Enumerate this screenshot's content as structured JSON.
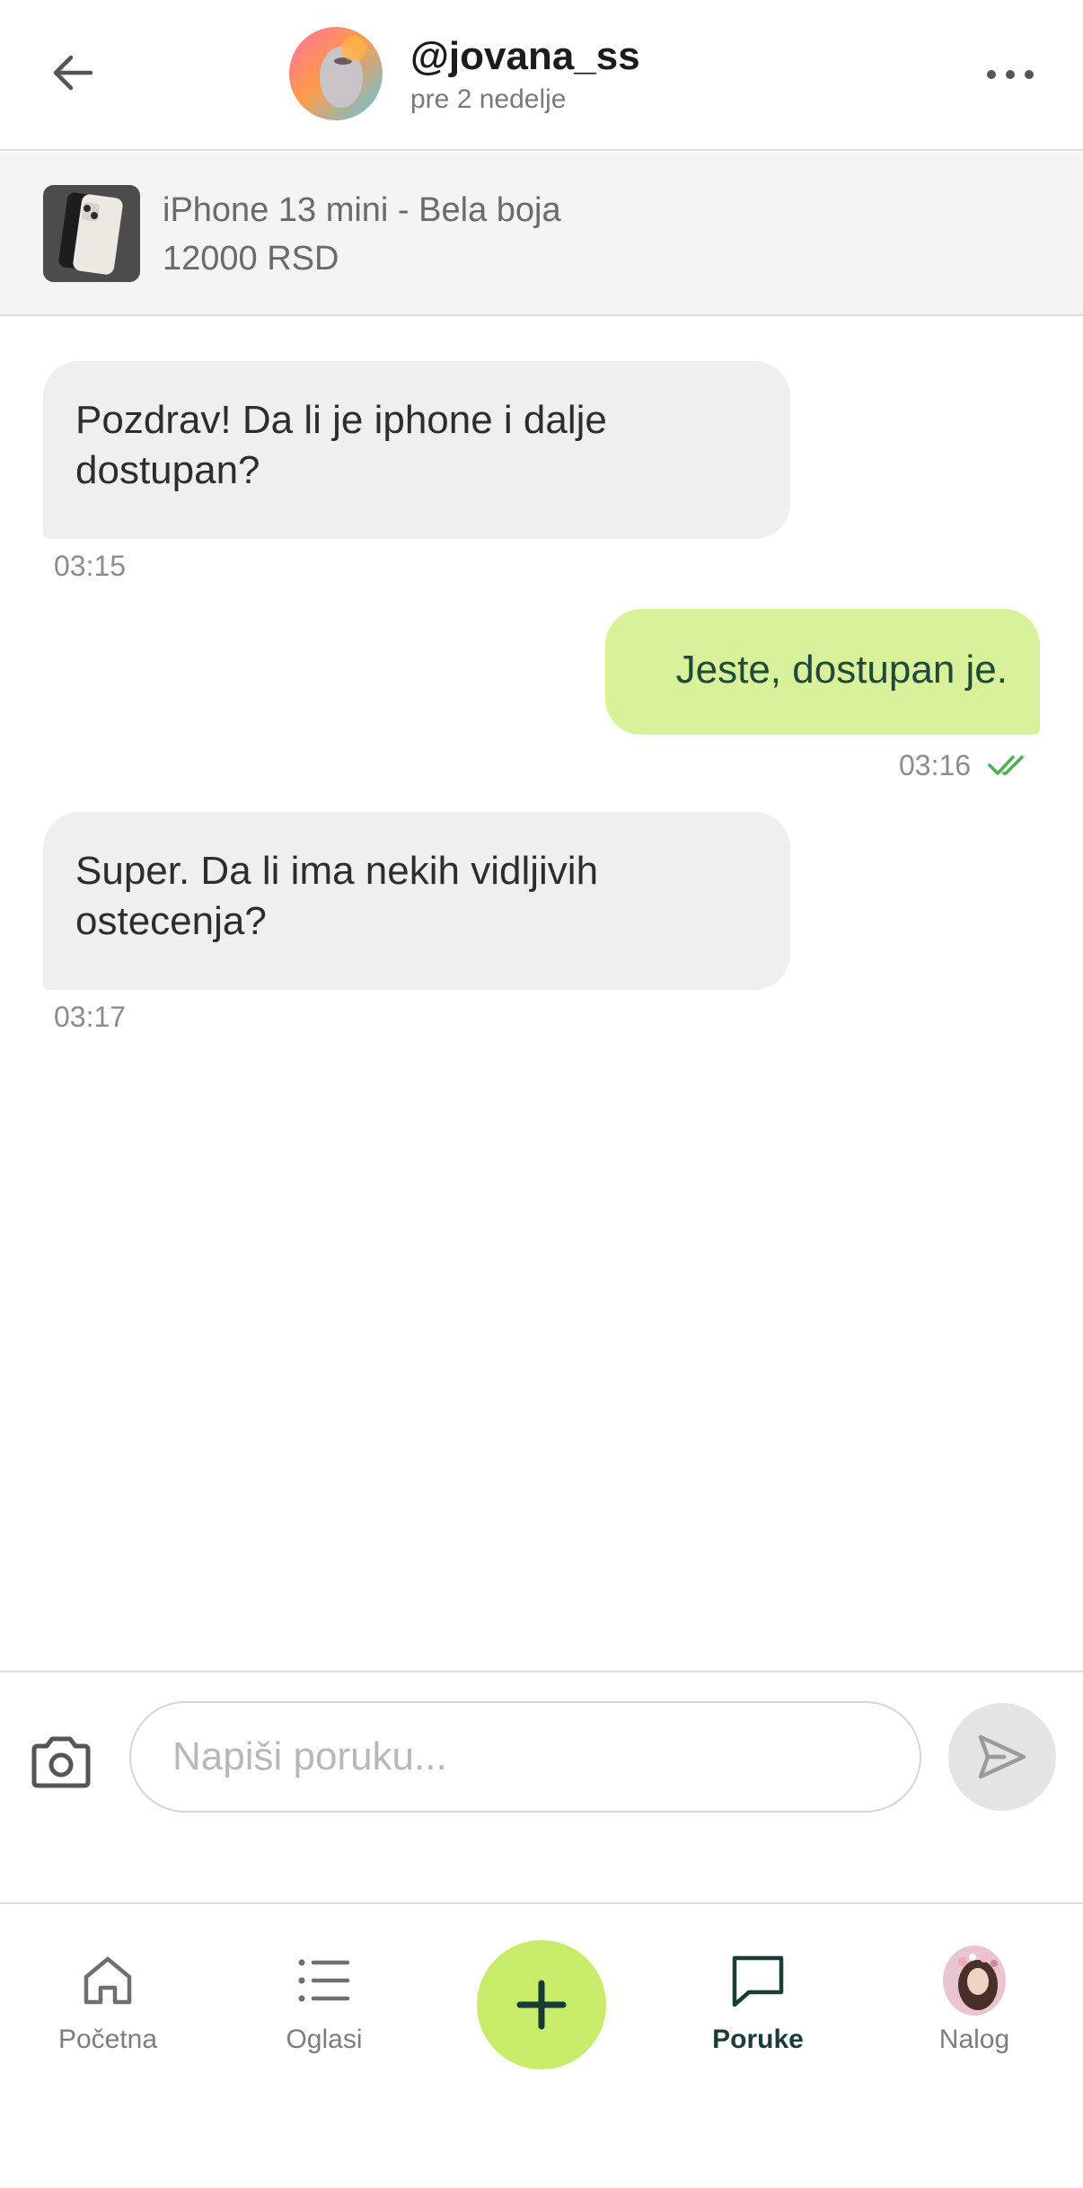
{
  "header": {
    "username": "@jovana_ss",
    "last_seen": "pre 2 nedelje"
  },
  "listing": {
    "title": "iPhone 13 mini - Bela boja",
    "price": "12000 RSD"
  },
  "messages": [
    {
      "direction": "incoming",
      "text": "Pozdrav! Da li je iphone i dalje dostupan?",
      "time": "03:15"
    },
    {
      "direction": "outgoing",
      "text": "Jeste, dostupan je.",
      "time": "03:16",
      "status": "read"
    },
    {
      "direction": "incoming",
      "text": "Super. Da li ima nekih vidljivih ostecenja?",
      "time": "03:17"
    }
  ],
  "composer": {
    "placeholder": "Napiši poruku..."
  },
  "nav": {
    "items": [
      {
        "label": "Početna",
        "icon": "home-icon"
      },
      {
        "label": "Oglasi",
        "icon": "list-icon"
      },
      {
        "label": "",
        "icon": "plus-icon"
      },
      {
        "label": "Poruke",
        "icon": "message-icon",
        "active": true
      },
      {
        "label": "Nalog",
        "icon": "avatar"
      }
    ]
  },
  "colors": {
    "accent": "#c6ec6a",
    "outgoing_bubble": "#d9f19b",
    "incoming_bubble": "#efefef",
    "read_check": "#4caf50",
    "active_nav": "#1a3d3a"
  }
}
